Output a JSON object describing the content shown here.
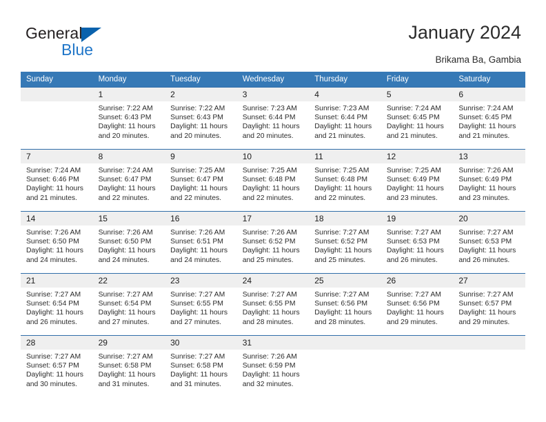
{
  "brand": {
    "name_top": "General",
    "name_bottom": "Blue",
    "color_dark": "#231f20",
    "color_blue": "#2076c8",
    "triangle_color": "#0a62ad"
  },
  "header": {
    "title": "January 2024",
    "location": "Brikama Ba, Gambia"
  },
  "theme": {
    "header_row_bg": "#3679b6",
    "row_divider": "#2f6da8",
    "daynum_bg": "#efefef"
  },
  "weekdays": [
    "Sunday",
    "Monday",
    "Tuesday",
    "Wednesday",
    "Thursday",
    "Friday",
    "Saturday"
  ],
  "weeks": [
    [
      {
        "day": "",
        "lines": []
      },
      {
        "day": "1",
        "lines": [
          "Sunrise: 7:22 AM",
          "Sunset: 6:43 PM",
          "Daylight: 11 hours",
          "and 20 minutes."
        ]
      },
      {
        "day": "2",
        "lines": [
          "Sunrise: 7:22 AM",
          "Sunset: 6:43 PM",
          "Daylight: 11 hours",
          "and 20 minutes."
        ]
      },
      {
        "day": "3",
        "lines": [
          "Sunrise: 7:23 AM",
          "Sunset: 6:44 PM",
          "Daylight: 11 hours",
          "and 20 minutes."
        ]
      },
      {
        "day": "4",
        "lines": [
          "Sunrise: 7:23 AM",
          "Sunset: 6:44 PM",
          "Daylight: 11 hours",
          "and 21 minutes."
        ]
      },
      {
        "day": "5",
        "lines": [
          "Sunrise: 7:24 AM",
          "Sunset: 6:45 PM",
          "Daylight: 11 hours",
          "and 21 minutes."
        ]
      },
      {
        "day": "6",
        "lines": [
          "Sunrise: 7:24 AM",
          "Sunset: 6:45 PM",
          "Daylight: 11 hours",
          "and 21 minutes."
        ]
      }
    ],
    [
      {
        "day": "7",
        "lines": [
          "Sunrise: 7:24 AM",
          "Sunset: 6:46 PM",
          "Daylight: 11 hours",
          "and 21 minutes."
        ]
      },
      {
        "day": "8",
        "lines": [
          "Sunrise: 7:24 AM",
          "Sunset: 6:47 PM",
          "Daylight: 11 hours",
          "and 22 minutes."
        ]
      },
      {
        "day": "9",
        "lines": [
          "Sunrise: 7:25 AM",
          "Sunset: 6:47 PM",
          "Daylight: 11 hours",
          "and 22 minutes."
        ]
      },
      {
        "day": "10",
        "lines": [
          "Sunrise: 7:25 AM",
          "Sunset: 6:48 PM",
          "Daylight: 11 hours",
          "and 22 minutes."
        ]
      },
      {
        "day": "11",
        "lines": [
          "Sunrise: 7:25 AM",
          "Sunset: 6:48 PM",
          "Daylight: 11 hours",
          "and 22 minutes."
        ]
      },
      {
        "day": "12",
        "lines": [
          "Sunrise: 7:25 AM",
          "Sunset: 6:49 PM",
          "Daylight: 11 hours",
          "and 23 minutes."
        ]
      },
      {
        "day": "13",
        "lines": [
          "Sunrise: 7:26 AM",
          "Sunset: 6:49 PM",
          "Daylight: 11 hours",
          "and 23 minutes."
        ]
      }
    ],
    [
      {
        "day": "14",
        "lines": [
          "Sunrise: 7:26 AM",
          "Sunset: 6:50 PM",
          "Daylight: 11 hours",
          "and 24 minutes."
        ]
      },
      {
        "day": "15",
        "lines": [
          "Sunrise: 7:26 AM",
          "Sunset: 6:50 PM",
          "Daylight: 11 hours",
          "and 24 minutes."
        ]
      },
      {
        "day": "16",
        "lines": [
          "Sunrise: 7:26 AM",
          "Sunset: 6:51 PM",
          "Daylight: 11 hours",
          "and 24 minutes."
        ]
      },
      {
        "day": "17",
        "lines": [
          "Sunrise: 7:26 AM",
          "Sunset: 6:52 PM",
          "Daylight: 11 hours",
          "and 25 minutes."
        ]
      },
      {
        "day": "18",
        "lines": [
          "Sunrise: 7:27 AM",
          "Sunset: 6:52 PM",
          "Daylight: 11 hours",
          "and 25 minutes."
        ]
      },
      {
        "day": "19",
        "lines": [
          "Sunrise: 7:27 AM",
          "Sunset: 6:53 PM",
          "Daylight: 11 hours",
          "and 26 minutes."
        ]
      },
      {
        "day": "20",
        "lines": [
          "Sunrise: 7:27 AM",
          "Sunset: 6:53 PM",
          "Daylight: 11 hours",
          "and 26 minutes."
        ]
      }
    ],
    [
      {
        "day": "21",
        "lines": [
          "Sunrise: 7:27 AM",
          "Sunset: 6:54 PM",
          "Daylight: 11 hours",
          "and 26 minutes."
        ]
      },
      {
        "day": "22",
        "lines": [
          "Sunrise: 7:27 AM",
          "Sunset: 6:54 PM",
          "Daylight: 11 hours",
          "and 27 minutes."
        ]
      },
      {
        "day": "23",
        "lines": [
          "Sunrise: 7:27 AM",
          "Sunset: 6:55 PM",
          "Daylight: 11 hours",
          "and 27 minutes."
        ]
      },
      {
        "day": "24",
        "lines": [
          "Sunrise: 7:27 AM",
          "Sunset: 6:55 PM",
          "Daylight: 11 hours",
          "and 28 minutes."
        ]
      },
      {
        "day": "25",
        "lines": [
          "Sunrise: 7:27 AM",
          "Sunset: 6:56 PM",
          "Daylight: 11 hours",
          "and 28 minutes."
        ]
      },
      {
        "day": "26",
        "lines": [
          "Sunrise: 7:27 AM",
          "Sunset: 6:56 PM",
          "Daylight: 11 hours",
          "and 29 minutes."
        ]
      },
      {
        "day": "27",
        "lines": [
          "Sunrise: 7:27 AM",
          "Sunset: 6:57 PM",
          "Daylight: 11 hours",
          "and 29 minutes."
        ]
      }
    ],
    [
      {
        "day": "28",
        "lines": [
          "Sunrise: 7:27 AM",
          "Sunset: 6:57 PM",
          "Daylight: 11 hours",
          "and 30 minutes."
        ]
      },
      {
        "day": "29",
        "lines": [
          "Sunrise: 7:27 AM",
          "Sunset: 6:58 PM",
          "Daylight: 11 hours",
          "and 31 minutes."
        ]
      },
      {
        "day": "30",
        "lines": [
          "Sunrise: 7:27 AM",
          "Sunset: 6:58 PM",
          "Daylight: 11 hours",
          "and 31 minutes."
        ]
      },
      {
        "day": "31",
        "lines": [
          "Sunrise: 7:26 AM",
          "Sunset: 6:59 PM",
          "Daylight: 11 hours",
          "and 32 minutes."
        ]
      },
      {
        "day": "",
        "lines": []
      },
      {
        "day": "",
        "lines": []
      },
      {
        "day": "",
        "lines": []
      }
    ]
  ]
}
